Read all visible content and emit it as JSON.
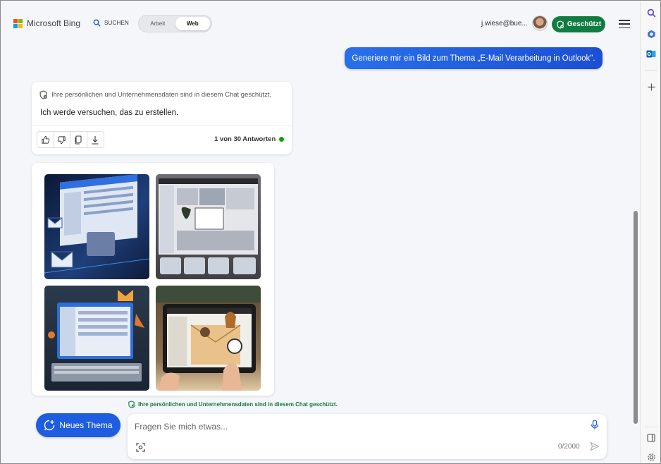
{
  "header": {
    "brand": "Microsoft Bing",
    "search_label": "SUCHEN",
    "toggle": {
      "work": "Arbeit",
      "web": "Web"
    },
    "user_email": "j.wiese@bue...",
    "protected_label": "Geschützt"
  },
  "conversation": {
    "user_message": "Generiere mir ein Bild zum Thema „E-Mail Verarbeitung in Outlook\".",
    "privacy_note": "Ihre persönlichen und Unternehmensdaten sind in diesem Chat geschützt.",
    "bot_reply": "Ich werde versuchen, das zu erstellen.",
    "answer_count": "1 von 30 Antworten"
  },
  "composer": {
    "footer_privacy": "Ihre persönlichen und Unternehmensdaten sind in diesem Chat geschützt.",
    "new_topic": "Neues Thema",
    "placeholder": "Fragen Sie mich etwas...",
    "char_count": "0/2000"
  },
  "colors": {
    "accent_blue": "#1f5de0",
    "protected_green": "#107c41",
    "status_green": "#13a10e"
  }
}
